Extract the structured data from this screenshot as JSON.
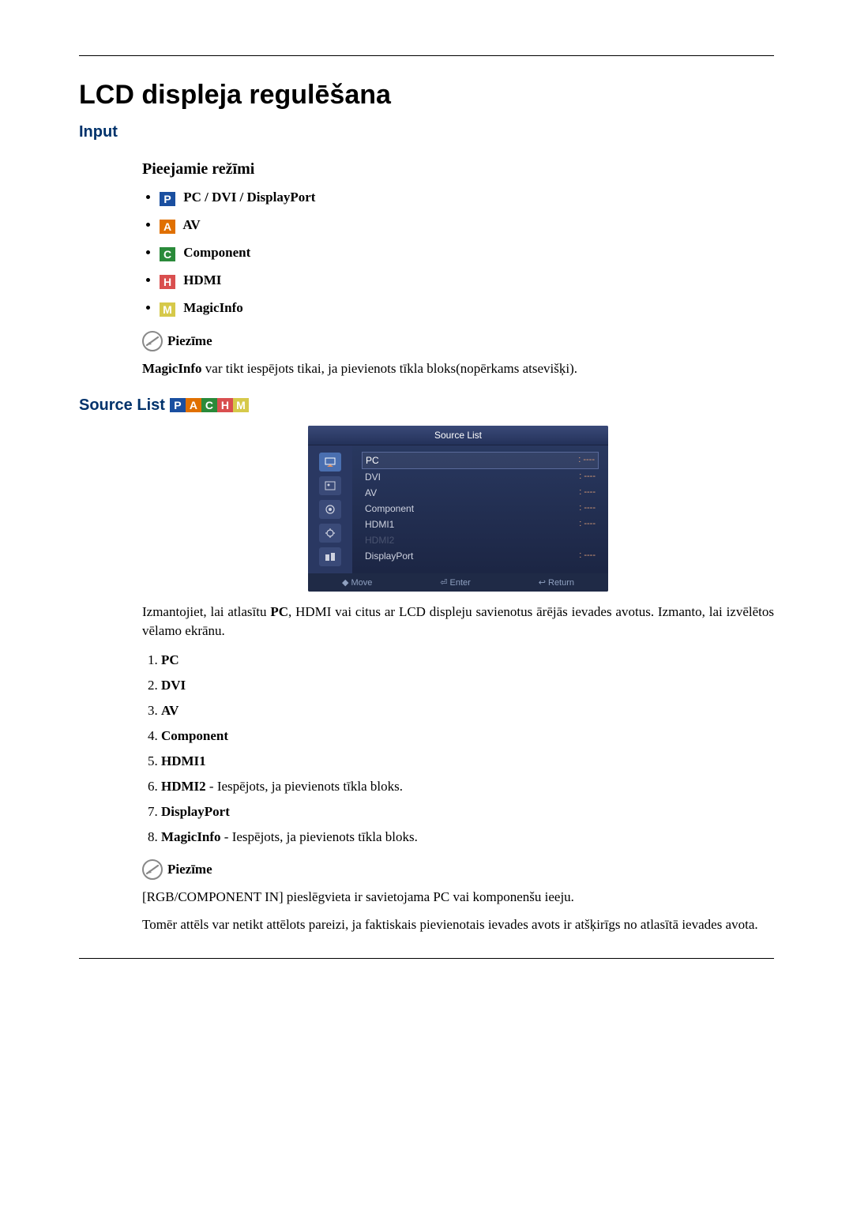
{
  "heading": "LCD displeja regulēšana",
  "section_input": {
    "title": "Input",
    "subheading": "Pieejamie režīmi",
    "modes": [
      {
        "icon": "P",
        "label": "PC / DVI / DisplayPort"
      },
      {
        "icon": "A",
        "label": "AV"
      },
      {
        "icon": "C",
        "label": "Component"
      },
      {
        "icon": "H",
        "label": "HDMI"
      },
      {
        "icon": "M",
        "label": "MagicInfo"
      }
    ],
    "note_label": "Piezīme",
    "note_body_bold": "MagicInfo",
    "note_body_rest": " var tikt iespējots tikai, ja pievienots tīkla bloks(nopērkams atsevišķi)."
  },
  "section_source": {
    "title": "Source List ",
    "icons": [
      "P",
      "A",
      "C",
      "H",
      "M"
    ],
    "osd": {
      "title": "Source List",
      "rows": [
        {
          "label": "PC",
          "val": ": ----",
          "state": "selected"
        },
        {
          "label": "DVI",
          "val": ": ----",
          "state": ""
        },
        {
          "label": "AV",
          "val": ": ----",
          "state": ""
        },
        {
          "label": "Component",
          "val": ": ----",
          "state": ""
        },
        {
          "label": "HDMI1",
          "val": ": ----",
          "state": ""
        },
        {
          "label": "HDMI2",
          "val": "",
          "state": "dim"
        },
        {
          "label": "DisplayPort",
          "val": ": ----",
          "state": ""
        }
      ],
      "footer": {
        "move": "Move",
        "enter": "Enter",
        "return": "Return"
      }
    },
    "desc_pre": "Izmantojiet, lai atlasītu ",
    "desc_bold": "PC",
    "desc_post": ", HDMI vai citus ar LCD displeju savienotus ārējās ievades avotus. Izmanto, lai izvēlētos vēlamo ekrānu.",
    "list": [
      {
        "bold": "PC",
        "rest": ""
      },
      {
        "bold": "DVI",
        "rest": ""
      },
      {
        "bold": "AV",
        "rest": ""
      },
      {
        "bold": "Component",
        "rest": ""
      },
      {
        "bold": "HDMI1",
        "rest": ""
      },
      {
        "bold": "HDMI2",
        "rest": " - Iespējots, ja pievienots tīkla bloks."
      },
      {
        "bold": "DisplayPort",
        "rest": ""
      },
      {
        "bold": "MagicInfo",
        "rest": " - Iespējots, ja pievienots tīkla bloks."
      }
    ],
    "note2_label": "Piezīme",
    "note2_p1": "[RGB/COMPONENT IN] pieslēgvieta ir savietojama PC vai komponenšu ieeju.",
    "note2_p2": "Tomēr attēls var netikt attēlots pareizi, ja faktiskais pievienotais ievades avots ir atšķirīgs no atlasītā ievades avota."
  }
}
